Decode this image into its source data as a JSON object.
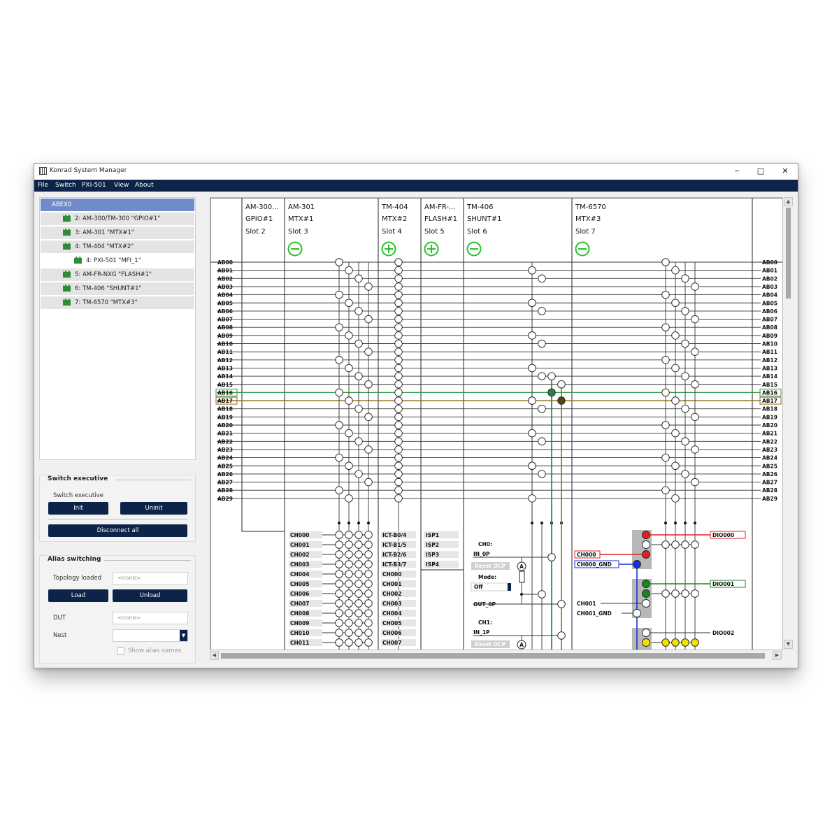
{
  "window": {
    "title": "Konrad System Manager",
    "minimize": "–",
    "maximize": "□",
    "close": "✕"
  },
  "menu": [
    "File",
    "Switch",
    "PXI-501",
    "View",
    "About"
  ],
  "tree": {
    "items": [
      {
        "label": "ABEX0",
        "level": 0,
        "selected": true,
        "chip": false
      },
      {
        "label": "2: AM-300/TM-300 \"GPIO#1\"",
        "level": 1,
        "chip": true
      },
      {
        "label": "3: AM-301 \"MTX#1\"",
        "level": 1,
        "chip": true
      },
      {
        "label": "4: TM-404 \"MTX#2\"",
        "level": 1,
        "chip": true
      },
      {
        "label": "4: PXI-501 \"MFI_1\"",
        "level": 2,
        "chip": true
      },
      {
        "label": "5: AM-FR-NXG \"FLASH#1\"",
        "level": 1,
        "chip": true
      },
      {
        "label": "6: TM-406 \"SHUNT#1\"",
        "level": 1,
        "chip": true
      },
      {
        "label": "7: TM-6570 \"MTX#3\"",
        "level": 1,
        "chip": true
      }
    ]
  },
  "switch_exec": {
    "title": "Switch executive",
    "label": "Switch executive",
    "init": "Init",
    "uninit": "Uninit",
    "disconnect": "Disconnect all"
  },
  "alias": {
    "title": "Alias switching",
    "topology_label": "Topology loaded",
    "topology_value": "<none>",
    "load": "Load",
    "unload": "Unload",
    "dut_label": "DUT",
    "dut_value": "<none>",
    "nest_label": "Nest",
    "nest_value": "",
    "show_alias": "Show alias names"
  },
  "scroll": {
    "up": "▲",
    "down": "▼",
    "left": "◀",
    "right": "▶"
  },
  "diagram": {
    "modules": [
      {
        "name": "AM-300...",
        "alias": "GPIO#1",
        "slot": "Slot 2",
        "sign": ""
      },
      {
        "name": "AM-301",
        "alias": "MTX#1",
        "slot": "Slot 3",
        "sign": "−"
      },
      {
        "name": "TM-404",
        "alias": "MTX#2",
        "slot": "Slot 4",
        "sign": "+"
      },
      {
        "name": "AM-FR-...",
        "alias": "FLASH#1",
        "slot": "Slot 5",
        "sign": "+"
      },
      {
        "name": "TM-406",
        "alias": "SHUNT#1",
        "slot": "Slot 6",
        "sign": "−"
      },
      {
        "name": "TM-6570",
        "alias": "MTX#3",
        "slot": "Slot 7",
        "sign": "−"
      }
    ],
    "bus_lines": [
      "AB00",
      "AB01",
      "AB02",
      "AB03",
      "AB04",
      "AB05",
      "AB06",
      "AB07",
      "AB08",
      "AB09",
      "AB10",
      "AB11",
      "AB12",
      "AB13",
      "AB14",
      "AB15",
      "AB16",
      "AB17",
      "AB18",
      "AB19",
      "AB20",
      "AB21",
      "AB22",
      "AB23",
      "AB24",
      "AB25",
      "AB26",
      "AB27",
      "AB28",
      "AB29"
    ],
    "highlight": {
      "AB16": "#2e9a3e",
      "AB17": "#8b6a14"
    },
    "mtx1_channels": [
      "CH000",
      "CH001",
      "CH002",
      "CH003",
      "CH004",
      "CH005",
      "CH006",
      "CH007",
      "CH008",
      "CH009",
      "CH010",
      "CH011"
    ],
    "mtx2_channels": [
      "ICT-B0/4",
      "ICT-B1/5",
      "ICT-B2/6",
      "ICT-B3/7",
      "CH000",
      "CH001",
      "CH002",
      "CH003",
      "CH004",
      "CH005",
      "CH006",
      "CH007"
    ],
    "flash_channels": [
      "ISP1",
      "ISP2",
      "ISP3",
      "ISP4"
    ],
    "shunt": {
      "ch0_label": "CH0:",
      "in0": "IN_0P",
      "reset": "Reset OCP",
      "mode_label": "Mode:",
      "mode_value": "Off",
      "out0": "OUT_0P",
      "ch1_label": "CH1:",
      "in1": "IN_1P",
      "meter": "A"
    },
    "mtx3": {
      "ch000": "CH000",
      "ch000_gnd": "CH000_GND",
      "ch001": "CH001",
      "ch001_gnd": "CH001_GND",
      "dio000": "DIO000",
      "dio001": "DIO001",
      "dio002": "DIO002"
    },
    "colors": {
      "red": "#e02020",
      "blue": "#1a2fd6",
      "green": "#178a1d",
      "yellow": "#f2e200",
      "plus_minus": "#28c028"
    }
  }
}
